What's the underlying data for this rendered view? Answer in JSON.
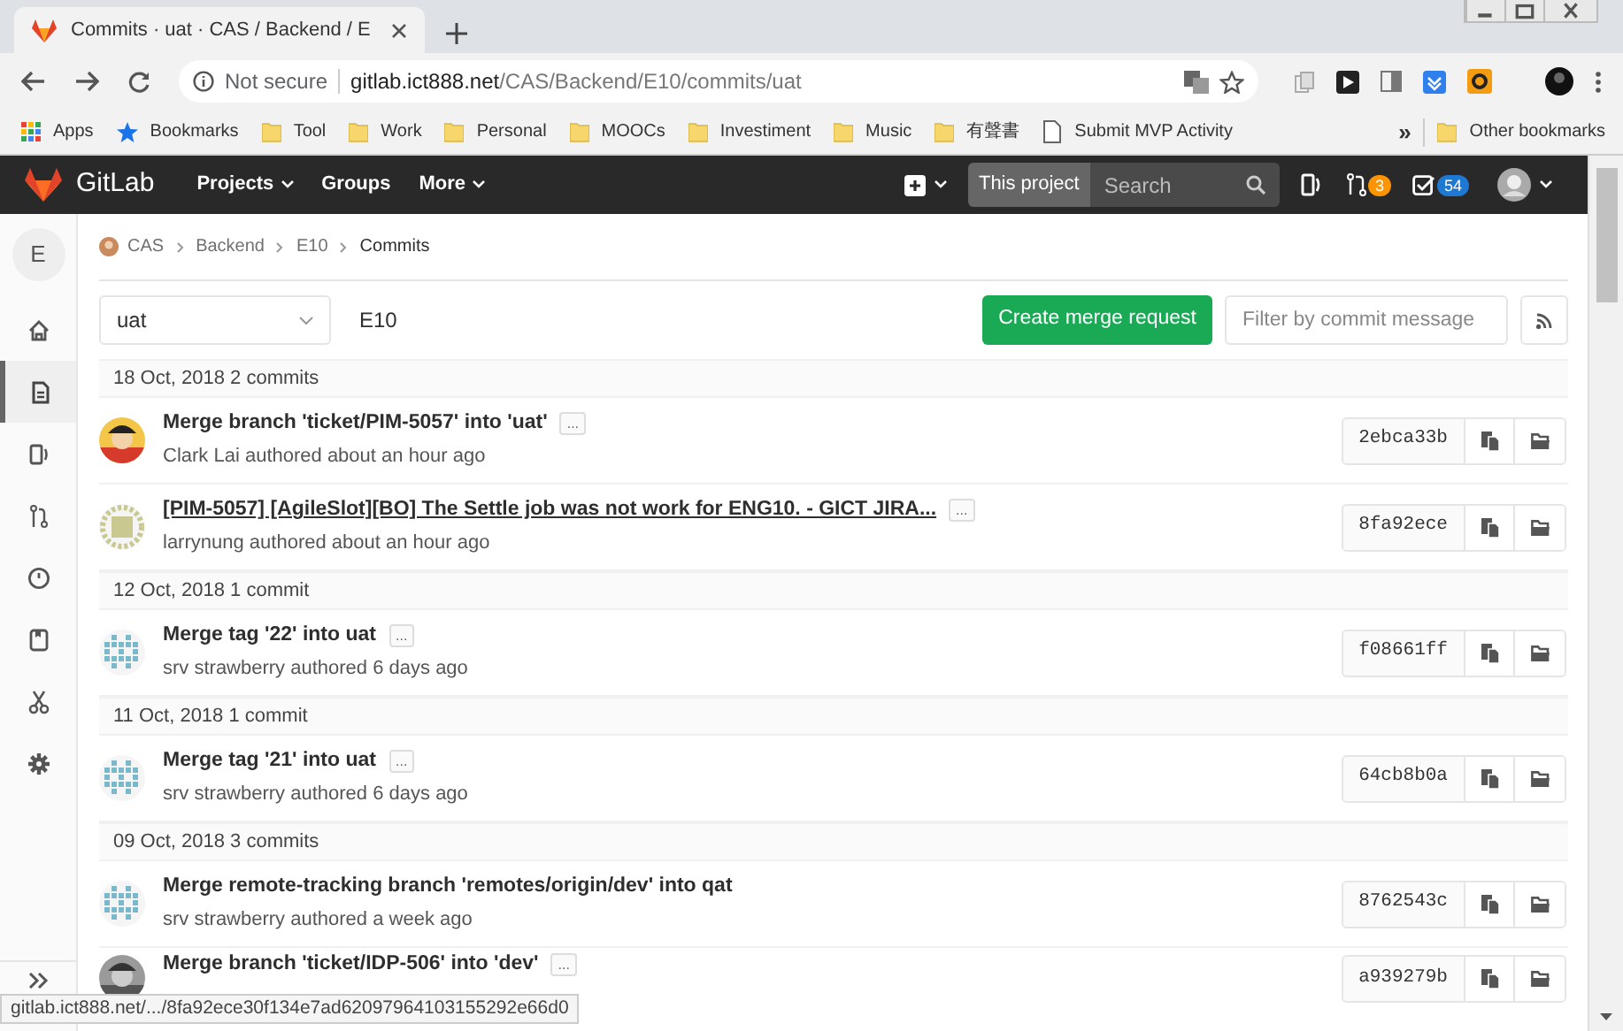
{
  "browser": {
    "tab_title": "Commits · uat · CAS / Backend / E",
    "address": {
      "security": "Not secure",
      "host": "gitlab.ict888.net",
      "path": "/CAS/Backend/E10/commits/uat"
    },
    "bookmarks": [
      {
        "kind": "apps",
        "label": "Apps"
      },
      {
        "kind": "star",
        "label": "Bookmarks"
      },
      {
        "kind": "folder",
        "label": "Tool"
      },
      {
        "kind": "folder",
        "label": "Work"
      },
      {
        "kind": "folder",
        "label": "Personal"
      },
      {
        "kind": "folder",
        "label": "MOOCs"
      },
      {
        "kind": "folder",
        "label": "Investiment"
      },
      {
        "kind": "folder",
        "label": "Music"
      },
      {
        "kind": "folder",
        "label": "有聲書"
      },
      {
        "kind": "page",
        "label": "Submit MVP Activity"
      }
    ],
    "overflow": "»",
    "other_bookmarks": "Other bookmarks"
  },
  "navbar": {
    "brand": "GitLab",
    "menus": [
      "Projects",
      "Groups",
      "More"
    ],
    "search_scope": "This project",
    "search_placeholder": "Search",
    "merge_requests_count": "3",
    "todos_count": "54"
  },
  "sidebar": {
    "project_letter": "E",
    "items": [
      {
        "kind": "home",
        "selected": false
      },
      {
        "kind": "repository",
        "selected": true
      },
      {
        "kind": "issues",
        "selected": false
      },
      {
        "kind": "merge",
        "selected": false
      },
      {
        "kind": "ci",
        "selected": false
      },
      {
        "kind": "wiki",
        "selected": false
      },
      {
        "kind": "snippets",
        "selected": false
      },
      {
        "kind": "settings",
        "selected": false
      }
    ]
  },
  "breadcrumbs": [
    "CAS",
    "Backend",
    "E10",
    "Commits"
  ],
  "toolbar": {
    "branch": "uat",
    "project": "E10",
    "create_button": "Create merge request",
    "filter_placeholder": "Filter by commit message"
  },
  "groups": [
    {
      "header": "18 Oct, 2018 2 commits",
      "commits": [
        {
          "title": "Merge branch 'ticket/PIM-5057' into 'uat'",
          "hovered": false,
          "more_button": "...",
          "byline": "Clark Lai authored about an hour ago",
          "sha": "2ebca33b"
        },
        {
          "kind": "identicon",
          "color": "#c8c890",
          "title": "[PIM-5057] [AgileSlot][BO] The Settle job was not work for ENG10. - GICT JIRA...",
          "hovered": true,
          "more_button": "...",
          "byline": "larrynung authored about an hour ago",
          "sha": "8fa92ece"
        }
      ]
    },
    {
      "header": "12 Oct, 2018 1 commit",
      "commits": [
        {
          "kind": "identicon",
          "color": "#7ab8cc",
          "title": "Merge tag '22' into uat",
          "hovered": false,
          "more_button": "...",
          "byline": "srv strawberry authored 6 days ago",
          "sha": "f08661ff"
        }
      ]
    },
    {
      "header": "11 Oct, 2018 1 commit",
      "commits": [
        {
          "kind": "identicon",
          "color": "#7ab8cc",
          "title": "Merge tag '21' into uat",
          "hovered": false,
          "more_button": "...",
          "byline": "srv strawberry authored 6 days ago",
          "sha": "64cb8b0a"
        }
      ]
    },
    {
      "header": "09 Oct, 2018 3 commits",
      "commits": [
        {
          "kind": "identicon",
          "color": "#7ab8cc",
          "title": "Merge remote-tracking branch 'remotes/origin/dev' into qat",
          "hovered": false,
          "byline": "srv strawberry authored a week ago",
          "sha": "8762543c"
        },
        {
          "title": "Merge branch 'ticket/IDP-506' into 'dev'",
          "hovered": false,
          "more_button": "...",
          "sha": "a939279b"
        }
      ]
    }
  ],
  "status_bar": "gitlab.ict888.net/.../8fa92ece30f134e7ad62097964103155292e66d0"
}
